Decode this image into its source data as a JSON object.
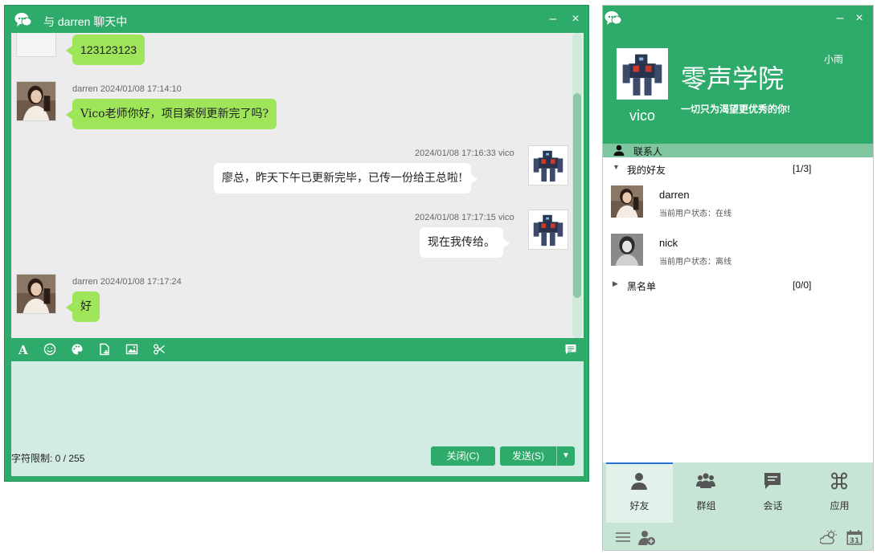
{
  "chat_window": {
    "title": "与 darren 聊天中",
    "minimize": "–",
    "close": "×",
    "messages": [
      {
        "sender": "",
        "time": "",
        "text": "123123123",
        "side": "left"
      },
      {
        "sender": "darren",
        "time": "2024/01/08 17:14:10",
        "text": "Vico老师你好，项目案例更新完了吗?",
        "side": "left"
      },
      {
        "sender": "vico",
        "time": "2024/01/08 17:16:33",
        "text": "廖总，昨天下午已更新完毕，已传一份给王总啦!",
        "side": "right"
      },
      {
        "sender": "vico",
        "time": "2024/01/08 17:17:15",
        "text": "现在我传给。",
        "side": "right"
      },
      {
        "sender": "darren",
        "time": "2024/01/08 17:17:24",
        "text": "好",
        "side": "left"
      }
    ],
    "char_limit": "字符限制: 0 / 255",
    "close_button": "关闭(C)",
    "send_button": "发送(S)",
    "send_dropdown": "▼"
  },
  "main_panel": {
    "minimize": "–",
    "close": "×",
    "my_name": "vico",
    "org_name": "零声学院",
    "top_right_name": "小雨",
    "slogan": "一切只为渴望更优秀的你!",
    "contacts_label": "联系人",
    "groups": [
      {
        "name": "我的好友",
        "count": "[1/3]",
        "arrow": "▼"
      },
      {
        "name": "黑名单",
        "count": "[0/0]",
        "arrow": "▶"
      }
    ],
    "friends": [
      {
        "name": "darren",
        "status": "当前用户状态：在线"
      },
      {
        "name": "nick",
        "status": "当前用户状态：离线"
      }
    ],
    "tabs": [
      {
        "label": "好友",
        "icon": "person-icon"
      },
      {
        "label": "群组",
        "icon": "group-icon"
      },
      {
        "label": "会话",
        "icon": "chat-icon"
      },
      {
        "label": "应用",
        "icon": "command-icon"
      }
    ],
    "calendar_day": "31"
  },
  "colors": {
    "accent": "#2eaa6a",
    "bubble_left": "#9ee55a",
    "bubble_right": "#ffffff",
    "input_bg": "#d3ece3",
    "tab_bar": "#c6e5d5"
  }
}
